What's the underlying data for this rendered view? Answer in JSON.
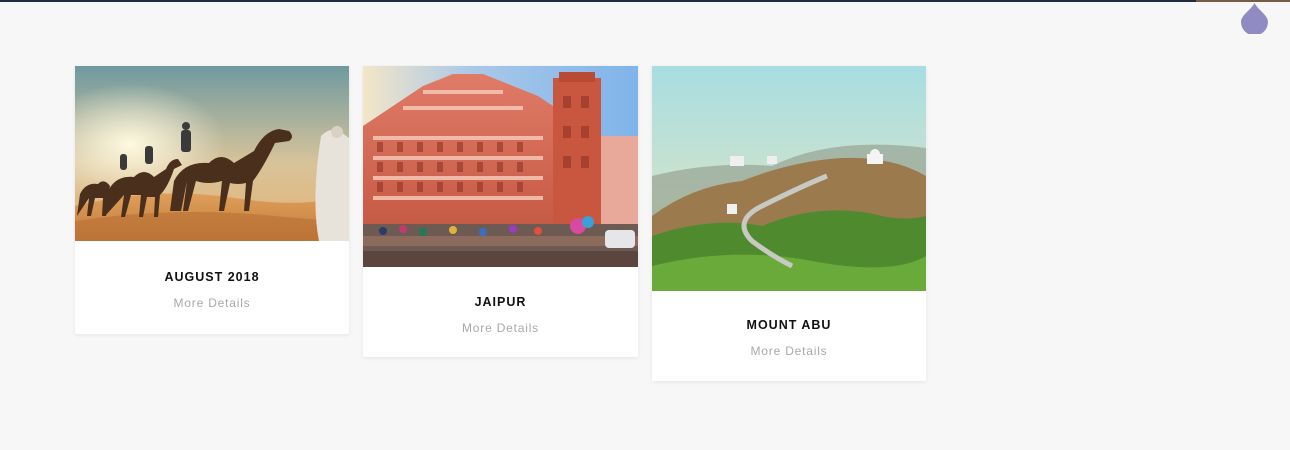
{
  "cards": [
    {
      "title": "AUGUST 2018",
      "link_label": "More Details",
      "image_icon": "camel-desert-photo"
    },
    {
      "title": "JAIPUR",
      "link_label": "More Details",
      "image_icon": "hawa-mahal-photo"
    },
    {
      "title": "MOUNT ABU",
      "link_label": "More Details",
      "image_icon": "mountain-road-photo"
    }
  ],
  "colors": {
    "background": "#f7f7f7",
    "top_bar": "#1f2a44",
    "badge": "#8a86c0",
    "title": "#111111",
    "link": "#a8a8a8"
  }
}
